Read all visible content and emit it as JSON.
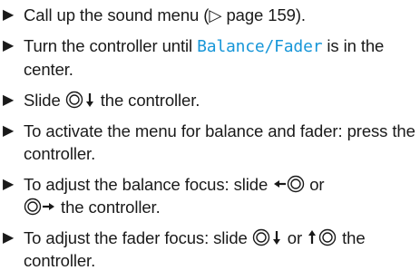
{
  "steps": [
    {
      "text_before": "Call up the sound menu (",
      "ref_glyph": "▷",
      "text_after": " page 159)."
    },
    {
      "text_before": "Turn the controller until ",
      "display_text": "Balance/Fader",
      "text_after": " is in the center."
    },
    {
      "text_before": "Slide ",
      "text_after": " the controller."
    },
    {
      "text": "To activate the menu for balance and fader: press the controller."
    },
    {
      "text_before": "To adjust the balance focus: slide ",
      "text_mid": " or ",
      "text_after": " the controller."
    },
    {
      "text_before": "To adjust the fader focus: slide ",
      "text_mid": " or ",
      "text_after": " the controller."
    }
  ],
  "icons": {
    "bullet": "triangle-right-icon",
    "controller": "controller-knob-icon",
    "arrows": [
      "arrow-down-icon",
      "arrow-left-icon",
      "arrow-right-icon",
      "arrow-up-icon"
    ]
  },
  "colors": {
    "text": "#1a1a1a",
    "display_text": "#1796d8"
  }
}
